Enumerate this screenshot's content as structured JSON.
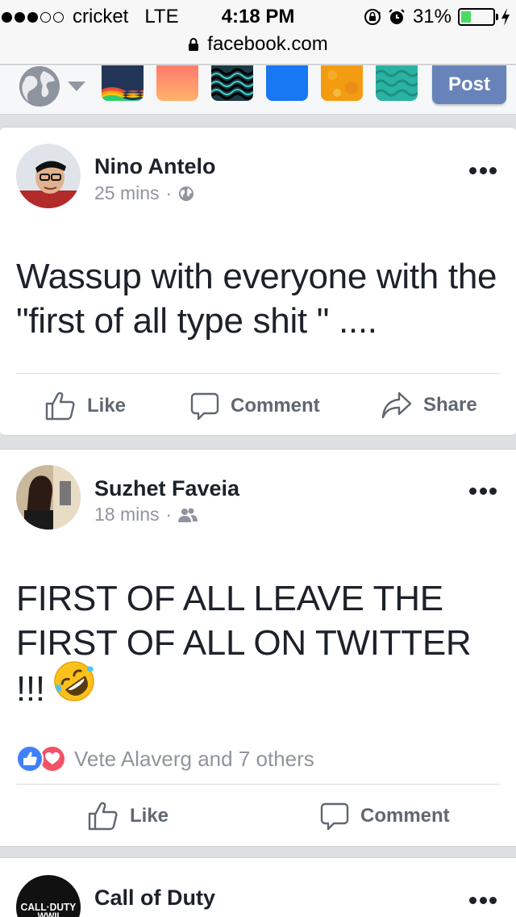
{
  "status_bar": {
    "carrier": "cricket",
    "network": "LTE",
    "time": "4:18 PM",
    "battery": "31%",
    "battery_level": 0.31,
    "url": "facebook.com"
  },
  "composer": {
    "post_label": "Post",
    "colors": {
      "navy": "#233657",
      "peach_top": "#ff7a6b",
      "peach_bottom": "#ffb46b",
      "blue": "#1877f2",
      "orange": "#f39c12",
      "teal": "#2ab3a3",
      "post_button": "#6883b9"
    }
  },
  "posts": [
    {
      "author": "Nino Antelo",
      "time": "25 mins",
      "privacy_icon": "globe-icon",
      "text": "Wassup with everyone with the \"first of all type shit \" ....",
      "actions": {
        "like": "Like",
        "comment": "Comment",
        "share": "Share"
      }
    },
    {
      "author": "Suzhet Faveia",
      "time": "18 mins",
      "privacy_icon": "friends-icon",
      "text": "FIRST OF ALL LEAVE THE FIRST OF ALL ON TWITTER !!!",
      "emoji": "rolling-on-floor-laughing",
      "reactions_text": "Vete Alaverg and 7 others",
      "actions": {
        "like": "Like",
        "comment": "Comment"
      }
    },
    {
      "author": "Call of Duty",
      "avatar_logo": "CALL·DUTY WWII"
    }
  ]
}
